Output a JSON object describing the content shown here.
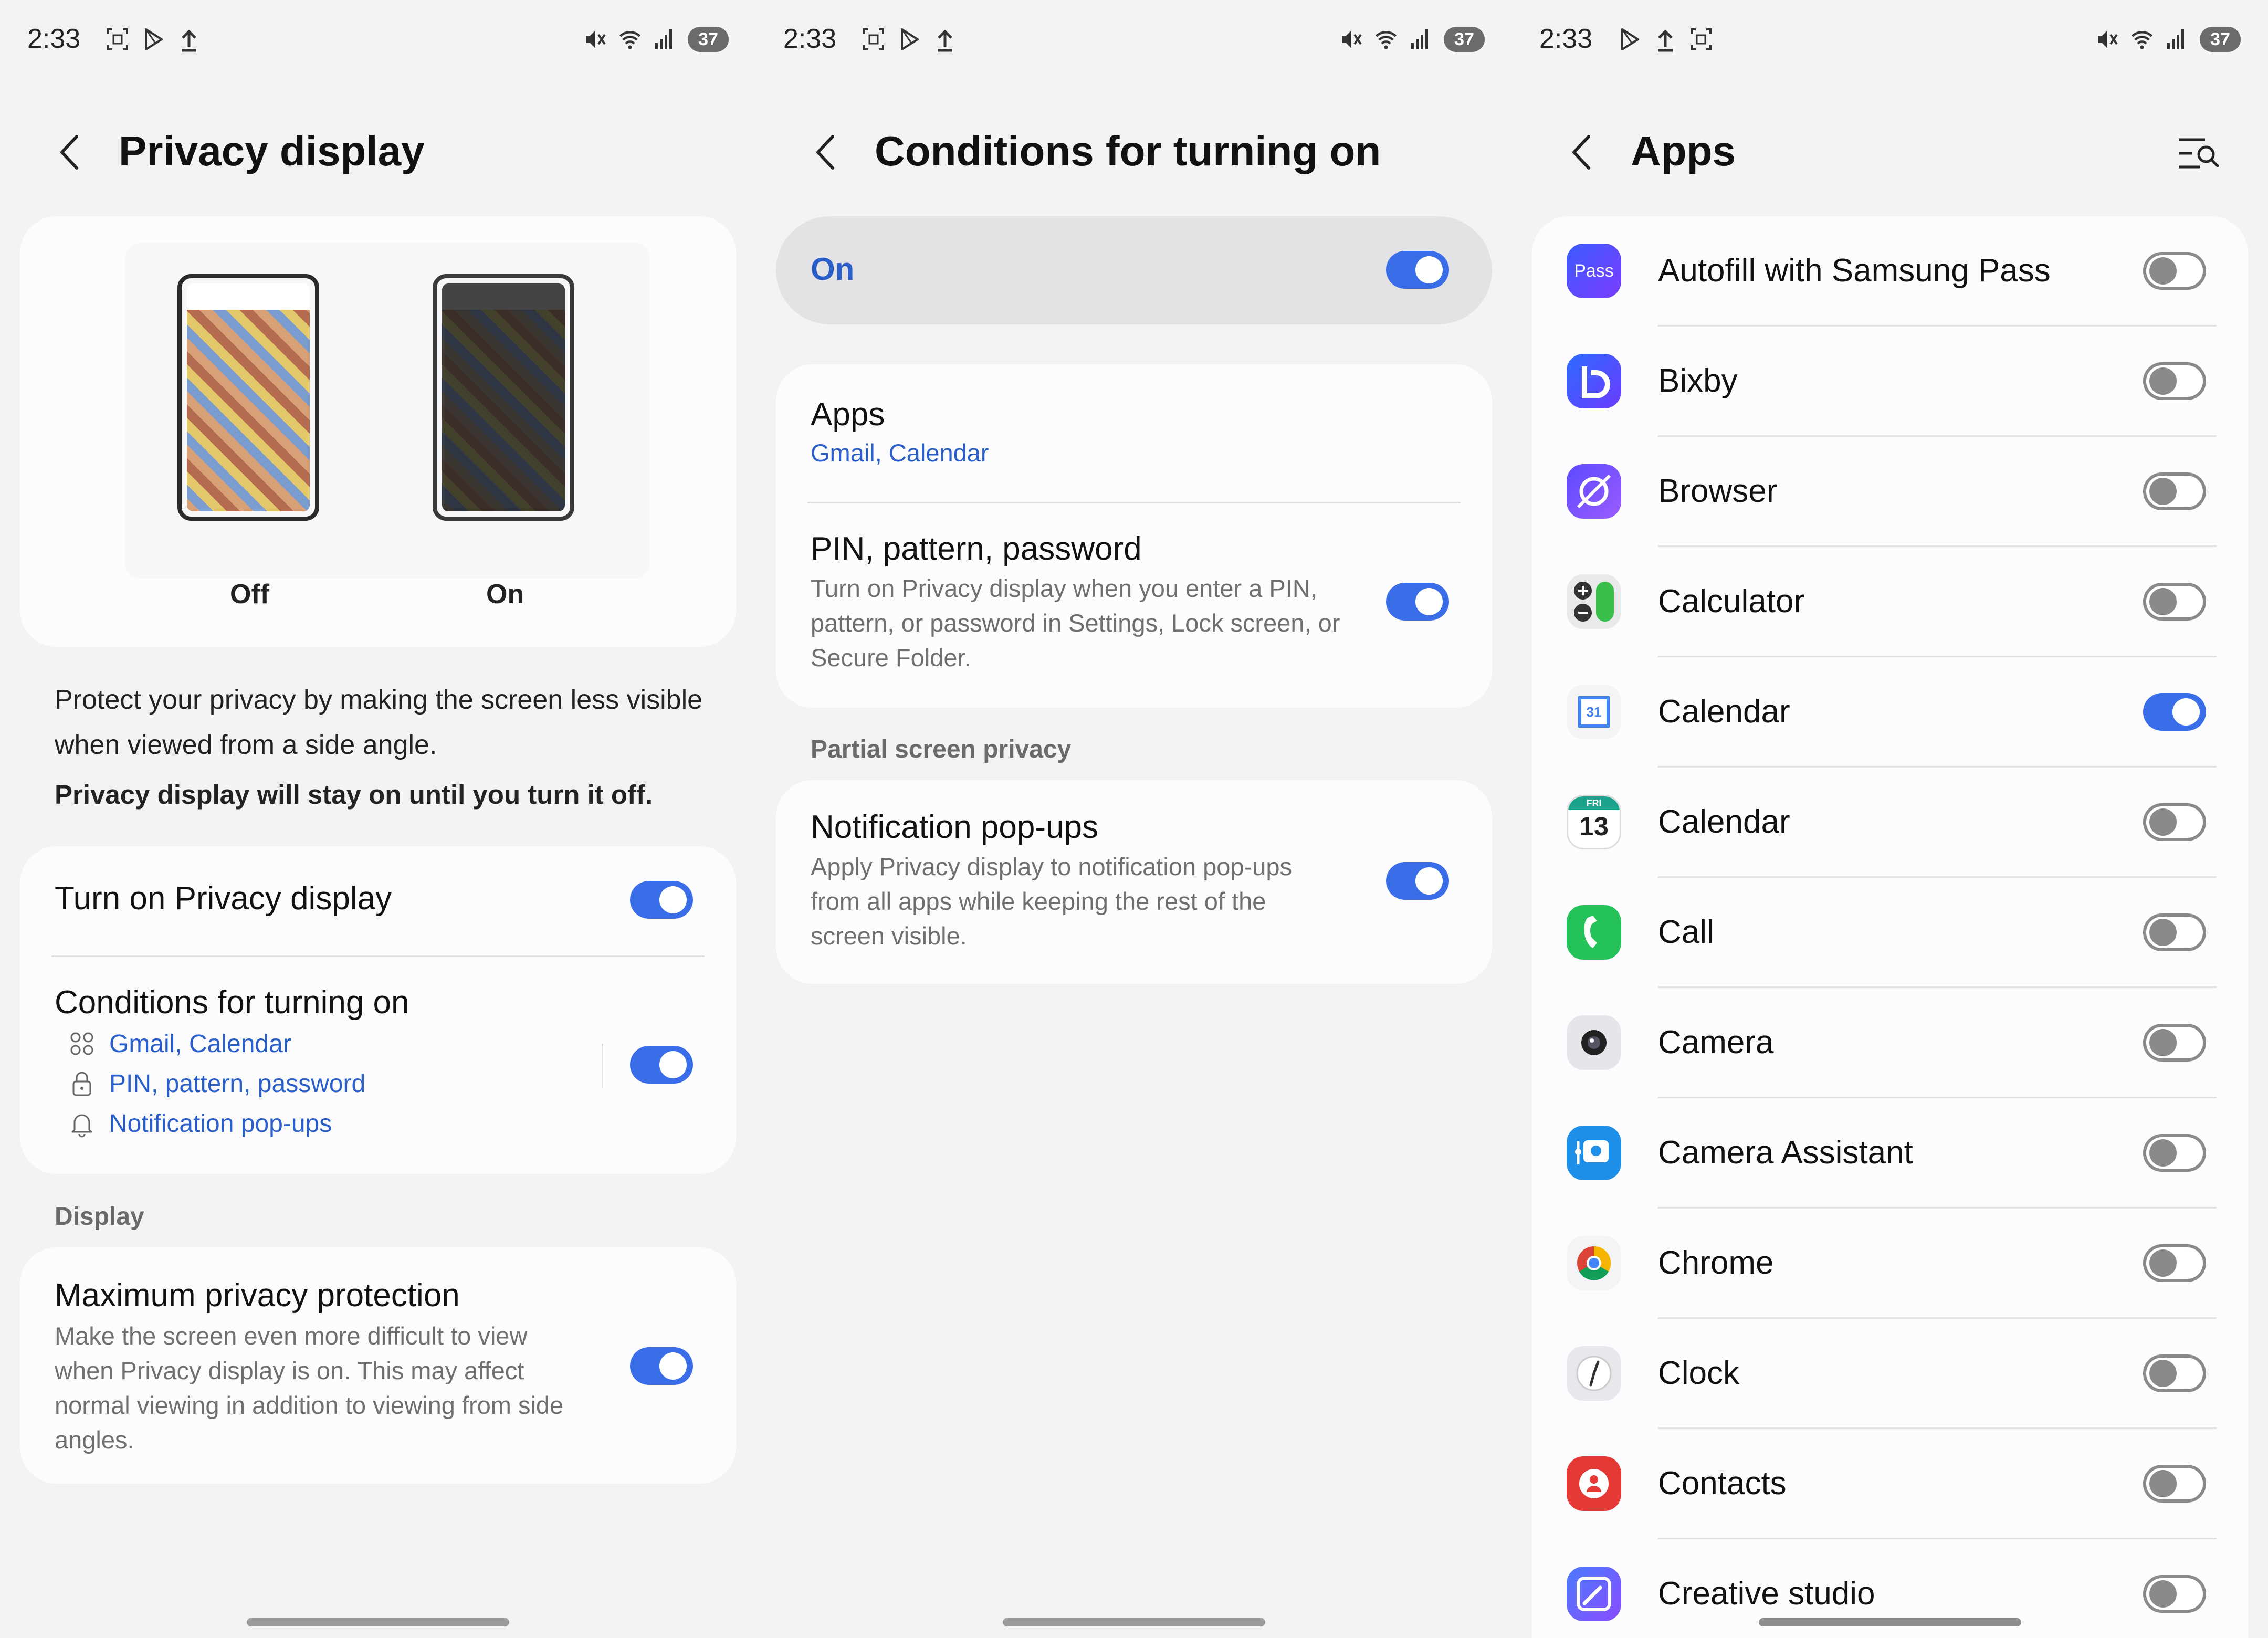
{
  "status": {
    "time": "2:33",
    "battery": "37"
  },
  "screen1": {
    "title": "Privacy display",
    "preview": {
      "off_label": "Off",
      "on_label": "On"
    },
    "description": "Protect your privacy by making the screen less visible when viewed from a side angle.",
    "description_bold": "Privacy display will stay on until you turn it off.",
    "turn_on": {
      "label": "Turn on Privacy display",
      "state": "on"
    },
    "conditions": {
      "label": "Conditions for turning on",
      "items": [
        "Gmail, Calendar",
        "PIN, pattern, password",
        "Notification pop-ups"
      ],
      "state": "on"
    },
    "section_display": "Display",
    "max_privacy": {
      "title": "Maximum privacy protection",
      "sub": "Make the screen even more difficult to view when Privacy display is on. This may affect normal viewing in addition to viewing from side angles.",
      "state": "on"
    }
  },
  "screen2": {
    "title": "Conditions for turning on",
    "master": {
      "label": "On",
      "state": "on"
    },
    "apps": {
      "title": "Apps",
      "value": "Gmail, Calendar"
    },
    "pin": {
      "title": "PIN, pattern, password",
      "sub": "Turn on Privacy display when you enter a PIN, pattern, or password in Settings, Lock screen, or Secure Folder.",
      "state": "on"
    },
    "section_partial": "Partial screen privacy",
    "notif": {
      "title": "Notification pop-ups",
      "sub": "Apply Privacy display to notification pop-ups from all apps while keeping the rest of the screen visible.",
      "state": "on"
    }
  },
  "screen3": {
    "title": "Apps",
    "apps": [
      {
        "name": "Autofill with Samsung Pass",
        "icon": "samsung-pass-icon",
        "icon_text": "Pass",
        "on": false
      },
      {
        "name": "Bixby",
        "icon": "bixby-icon",
        "on": false
      },
      {
        "name": "Browser",
        "icon": "browser-icon",
        "on": false
      },
      {
        "name": "Calculator",
        "icon": "calculator-icon",
        "on": false
      },
      {
        "name": "Calendar",
        "icon": "google-calendar-icon",
        "icon_text": "31",
        "on": true
      },
      {
        "name": "Calendar",
        "icon": "samsung-calendar-icon",
        "icon_text": "13",
        "icon_sub": "FRI",
        "on": false
      },
      {
        "name": "Call",
        "icon": "phone-icon",
        "on": false
      },
      {
        "name": "Camera",
        "icon": "camera-icon",
        "on": false
      },
      {
        "name": "Camera Assistant",
        "icon": "camera-assistant-icon",
        "on": false
      },
      {
        "name": "Chrome",
        "icon": "chrome-icon",
        "on": false
      },
      {
        "name": "Clock",
        "icon": "clock-icon",
        "on": false
      },
      {
        "name": "Contacts",
        "icon": "contacts-icon",
        "on": false
      },
      {
        "name": "Creative studio",
        "icon": "creative-studio-icon",
        "on": false
      }
    ]
  },
  "colors": {
    "accent": "#3a6ee8",
    "link": "#2a5fc9",
    "background": "#f3f3f5",
    "card": "#fcfcfe"
  }
}
